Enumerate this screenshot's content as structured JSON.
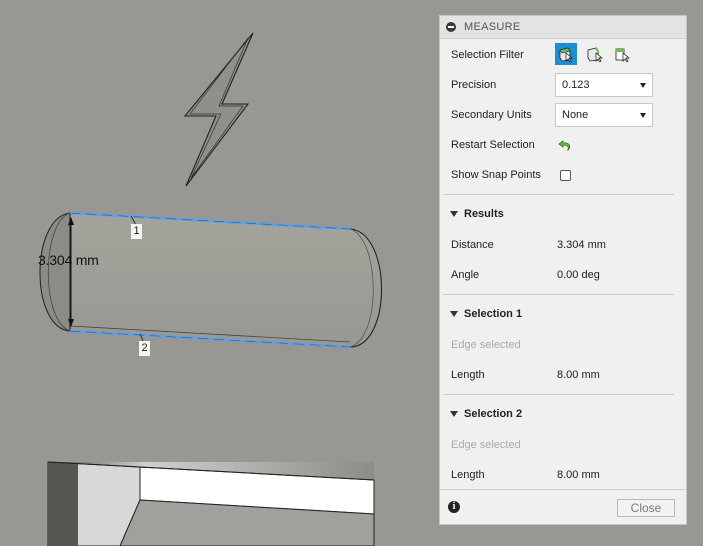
{
  "viewport": {
    "dimension_label": "3.304 mm",
    "edge_tags": [
      "1",
      "2"
    ]
  },
  "panel": {
    "title": "MEASURE",
    "selection_filter_label": "Selection Filter",
    "precision_label": "Precision",
    "precision_value": "0.123",
    "secondary_units_label": "Secondary Units",
    "secondary_units_value": "None",
    "restart_selection_label": "Restart Selection",
    "show_snap_points_label": "Show Snap Points",
    "show_snap_points_checked": false
  },
  "results": {
    "heading": "Results",
    "distance_label": "Distance",
    "distance_value": "3.304 mm",
    "angle_label": "Angle",
    "angle_value": "0.00 deg"
  },
  "selection1": {
    "heading": "Selection 1",
    "status": "Edge selected",
    "length_label": "Length",
    "length_value": "8.00 mm"
  },
  "selection2": {
    "heading": "Selection 2",
    "status": "Edge selected",
    "length_label": "Length",
    "length_value": "8.00 mm"
  },
  "footer": {
    "info_icon": "i",
    "close_label": "Close"
  },
  "colors": {
    "background": "#989793",
    "selection_highlight": "#5b9fe6",
    "active_filter": "#1a8fd6"
  }
}
